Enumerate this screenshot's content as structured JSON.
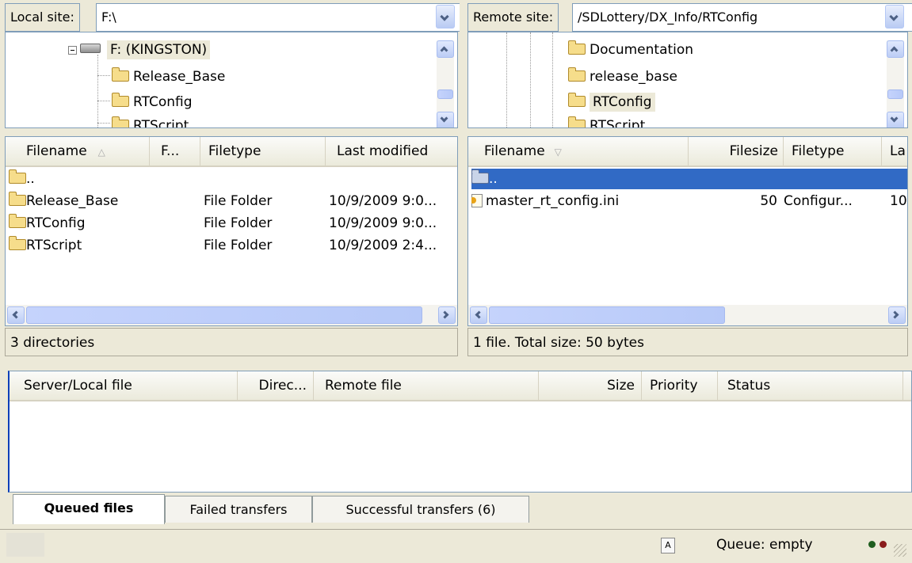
{
  "local": {
    "label": "Local site:",
    "path": "F:\\",
    "tree": [
      {
        "label": "F: (KINGSTON)",
        "icon": "drive-icon"
      },
      {
        "label": "Release_Base",
        "icon": "folder-icon"
      },
      {
        "label": "RTConfig",
        "icon": "folder-icon"
      },
      {
        "label": "RTScript",
        "icon": "folder-icon"
      }
    ],
    "columns": [
      "Filename",
      "F...",
      "Filetype",
      "Last modified"
    ],
    "rows": [
      {
        "name": "..",
        "type": "",
        "modified": ""
      },
      {
        "name": "Release_Base",
        "type": "File Folder",
        "modified": "10/9/2009 9:0..."
      },
      {
        "name": "RTConfig",
        "type": "File Folder",
        "modified": "10/9/2009 9:0..."
      },
      {
        "name": "RTScript",
        "type": "File Folder",
        "modified": "10/9/2009 2:4..."
      }
    ],
    "status": "3 directories"
  },
  "remote": {
    "label": "Remote site:",
    "path": "/SDLottery/DX_Info/RTConfig",
    "tree": [
      {
        "label": "Documentation",
        "icon": "folder-icon"
      },
      {
        "label": "release_base",
        "icon": "folder-icon"
      },
      {
        "label": "RTConfig",
        "icon": "folder-icon"
      },
      {
        "label": "RTScript",
        "icon": "folder-question-icon"
      }
    ],
    "columns": [
      "Filename",
      "Filesize",
      "Filetype",
      "La"
    ],
    "rows": [
      {
        "name": "..",
        "size": "",
        "type": "",
        "modified": ""
      },
      {
        "name": "master_rt_config.ini",
        "size": "50",
        "type": "Configur...",
        "modified": "10"
      }
    ],
    "status": "1 file. Total size: 50 bytes"
  },
  "queue": {
    "columns": [
      "Server/Local file",
      "Direc...",
      "Remote file",
      "Size",
      "Priority",
      "Status"
    ],
    "tabs": [
      "Queued files",
      "Failed transfers",
      "Successful transfers (6)"
    ],
    "status": "Queue: empty"
  },
  "colors": {
    "selection": "#316ac5",
    "accent": "#7f9db9"
  }
}
